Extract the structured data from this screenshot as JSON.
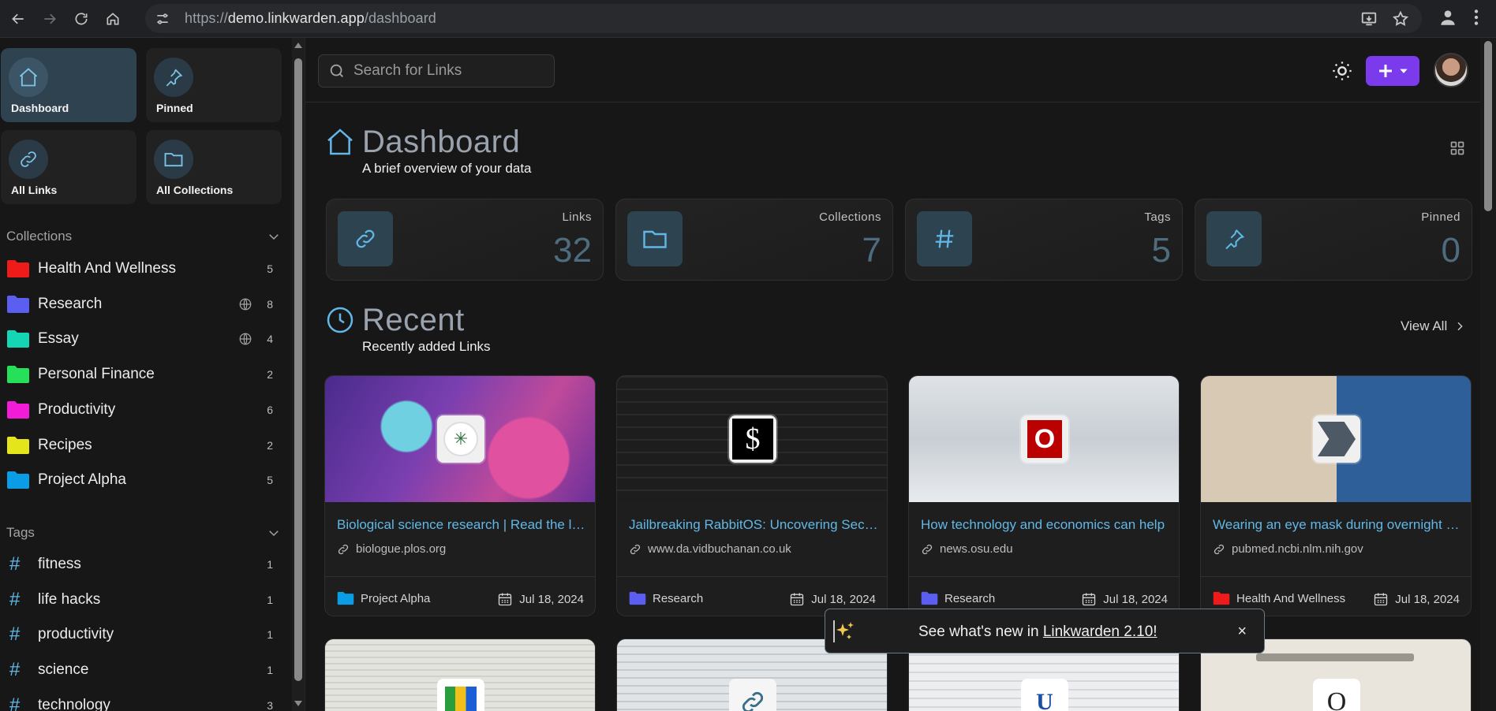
{
  "browser": {
    "url_scheme": "https://",
    "url_host": "demo.linkwarden.app",
    "url_path": "/dashboard"
  },
  "sidebar": {
    "quick": [
      {
        "label": "Dashboard",
        "icon": "house-icon"
      },
      {
        "label": "Pinned",
        "icon": "pin-icon"
      },
      {
        "label": "All Links",
        "icon": "link-icon"
      },
      {
        "label": "All Collections",
        "icon": "folder-icon"
      }
    ],
    "collections_heading": "Collections",
    "collections": [
      {
        "name": "Health And Wellness",
        "count": "5",
        "color": "#ef1b1b",
        "shared": false
      },
      {
        "name": "Research",
        "count": "8",
        "color": "#5b5ef0",
        "shared": true
      },
      {
        "name": "Essay",
        "count": "4",
        "color": "#14d6b4",
        "shared": true
      },
      {
        "name": "Personal Finance",
        "count": "2",
        "color": "#27e05a",
        "shared": false
      },
      {
        "name": "Productivity",
        "count": "6",
        "color": "#f21bd8",
        "shared": false
      },
      {
        "name": "Recipes",
        "count": "2",
        "color": "#e5e51c",
        "shared": false
      },
      {
        "name": "Project Alpha",
        "count": "5",
        "color": "#0b9ce6",
        "shared": false
      }
    ],
    "tags_heading": "Tags",
    "tags": [
      {
        "name": "fitness",
        "count": "1"
      },
      {
        "name": "life hacks",
        "count": "1"
      },
      {
        "name": "productivity",
        "count": "1"
      },
      {
        "name": "science",
        "count": "1"
      },
      {
        "name": "technology",
        "count": "3"
      }
    ]
  },
  "topbar": {
    "search_placeholder": "Search for Links"
  },
  "dashboard": {
    "title": "Dashboard",
    "subtitle": "A brief overview of your data",
    "stats": [
      {
        "label": "Links",
        "value": "32",
        "icon": "link-icon"
      },
      {
        "label": "Collections",
        "value": "7",
        "icon": "folder-icon"
      },
      {
        "label": "Tags",
        "value": "5",
        "icon": "hash-icon"
      },
      {
        "label": "Pinned",
        "value": "0",
        "icon": "pin-icon"
      }
    ]
  },
  "recent": {
    "title": "Recent",
    "subtitle": "Recently added Links",
    "view_all": "View All",
    "links": [
      {
        "title": "Biological science research | Read the latest on PLOS",
        "domain": "biologue.plos.org",
        "collection": "Project Alpha",
        "collection_color": "#0b9ce6",
        "date": "Jul 18, 2024"
      },
      {
        "title": "Jailbreaking RabbitOS: Uncovering Secret Logs",
        "domain": "www.da.vidbuchanan.co.uk",
        "collection": "Research",
        "collection_color": "#5b5ef0",
        "date": "Jul 18, 2024"
      },
      {
        "title": "How technology and economics can help",
        "domain": "news.osu.edu",
        "collection": "Research",
        "collection_color": "#5b5ef0",
        "date": "Jul 18, 2024"
      },
      {
        "title": "Wearing an eye mask during overnight sleep",
        "domain": "pubmed.ncbi.nlm.nih.gov",
        "collection": "Health And Wellness",
        "collection_color": "#ef1b1b",
        "date": "Jul 18, 2024"
      }
    ]
  },
  "toast": {
    "prefix": "See what's new in ",
    "link": "Linkwarden 2.10!",
    "close": "×"
  }
}
